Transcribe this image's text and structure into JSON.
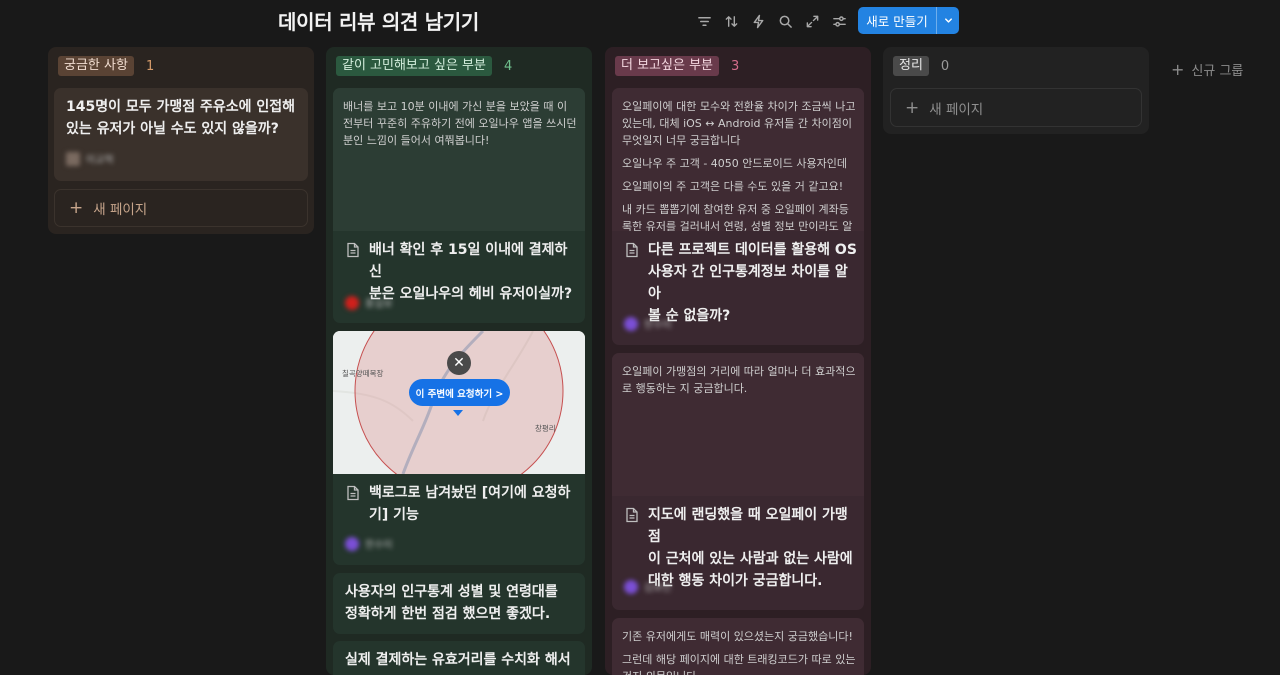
{
  "header": {
    "title": "데이터 리뷰 의견 남기기",
    "new_button_label": "새로 만들기"
  },
  "toolbar": {
    "icons": [
      "filter-icon",
      "sort-icon",
      "lightning-icon",
      "search-icon",
      "expand-icon",
      "settings-sliders-icon"
    ]
  },
  "colors": {
    "accent": "#2383e2",
    "background": "#191919"
  },
  "columns": [
    {
      "tag": "궁금한 사항",
      "count": "1",
      "tag_bg": "#5a4334",
      "count_color": "#d49a6a",
      "cards": [
        {
          "title": "145명이 모두 가맹점 주유소에 인접해 있는 유저가 아닐 수도 있지 않을까?",
          "author": "이교혁"
        }
      ],
      "add_label": "새 페이지"
    },
    {
      "tag": "같이 고민해보고 싶은 부분",
      "count": "4",
      "tag_bg": "#2b593f",
      "count_color": "#6fbf8c",
      "cards": [
        {
          "preview": "배너를 보고 10분 이내에 가신 분을 보았을 때 이전부터 꾸준히 주유하기 전에 오일나우 앱을 쓰시던 분인 느낌이 들어서 여쭤봅니다!",
          "title_lines": [
            "배너 확인 후 15일 이내에 결제하신",
            "분은 오일나우의 헤비 유저이실까?"
          ],
          "author": "홍길보"
        },
        {
          "map_pill": "이 주변에 요청하기 >",
          "map_label_1": "칠곡양떼목장",
          "map_label_2": "창평리",
          "title_lines": [
            "백로그로 남겨놨던 [여기에 요청하",
            "기] 기능"
          ],
          "author": "한수미"
        },
        {
          "title": "사용자의 인구통계 성별 및 연령대를 정확하게 한번 점검 했으면 좋겠다."
        },
        {
          "title": "실제 결제하는 유효거리를 수치화 해서"
        }
      ]
    },
    {
      "tag": "더 보고싶은 부분",
      "count": "3",
      "tag_bg": "#693a4b",
      "count_color": "#d56d8b",
      "cards": [
        {
          "preview_paras": [
            "오일페이에 대한 모수와 전환율 차이가 조금씩 나고 있는데, 대체 iOS ↔ Android 유저들 간 차이점이 무엇일지 너무 궁금합니다",
            "오일나우 주 고객 - 4050 안드로이드 사용자인데",
            "오일페이의 주 고객은 다를 수도 있을 거 같고요!",
            "내 카드 뽑뽑기에 참여한 유저 중 오일페이 계좌등록한 유저를 걸러내서 연령, 성별 정보 만이라도 알"
          ],
          "title_lines": [
            "다른 프로젝트 데이터를 활용해 OS",
            "사용자 간 인구통계정보 차이를 알아",
            "볼 순 없을까?"
          ],
          "author": "한수미"
        },
        {
          "preview": "오일페이 가맹점의 거리에 따라 얼마나 더 효과적으로 행동하는 지 궁금합니다.",
          "title_lines": [
            "지도에 랜딩했을 때 오일페이 가맹점",
            "이 근처에 있는 사람과 없는 사람에",
            "대한 행동 차이가 궁금합니다."
          ],
          "author": "김보민"
        },
        {
          "preview_paras": [
            "기존 유저에게도 매력이 있으셨는지 궁금했습니다!",
            "그런데 해당 페이지에 대한 트래킹코드가 따로 있는 건지 의문입니다."
          ]
        }
      ]
    },
    {
      "tag": "정리",
      "count": "0",
      "tag_bg": "#4a4a4a",
      "count_color": "#9b9b9b",
      "add_label": "새 페이지"
    }
  ],
  "new_group_label": "신규 그룹"
}
